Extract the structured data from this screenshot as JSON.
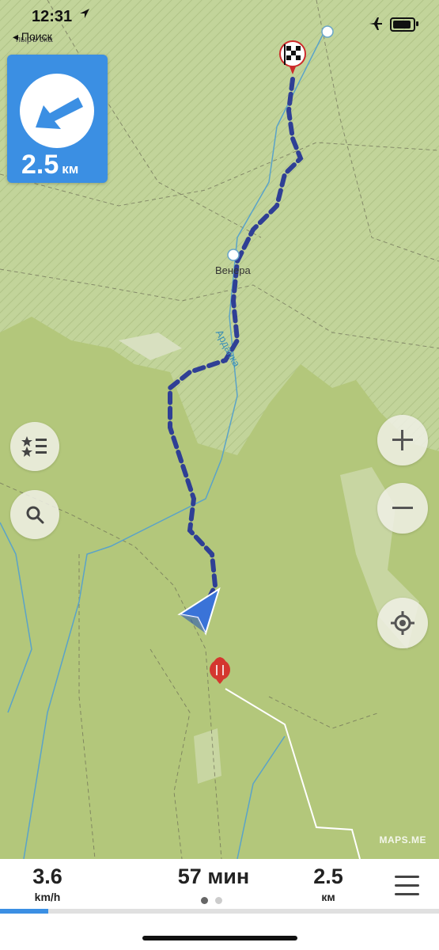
{
  "status": {
    "time": "12:31",
    "back_label": "Поиск"
  },
  "turn": {
    "distance": "2.5",
    "unit": "км"
  },
  "map": {
    "poi_label": "Венера",
    "river_label": "Арданка",
    "top_partial_label": "пыръ ска",
    "watermark": "MAPS.ME"
  },
  "controls": {
    "bookmarks_icon": "bookmark-list-icon",
    "search_icon": "search-icon",
    "zoom_in_icon": "plus-icon",
    "zoom_out_icon": "minus-icon",
    "locate_icon": "my-location-icon"
  },
  "bottom": {
    "speed": "3.6",
    "speed_unit": "km/h",
    "time_left": "57 мин",
    "distance": "2.5",
    "distance_unit": "км",
    "progress": 0.11
  },
  "colors": {
    "accent": "#3b8fe3",
    "route": "#2f3f95"
  }
}
